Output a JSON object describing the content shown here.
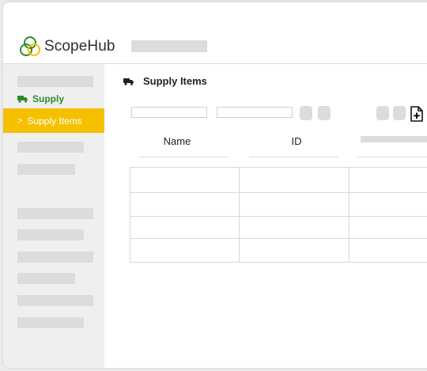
{
  "app": {
    "name": "ScopeHub",
    "brand_green": "#2e8b2e",
    "accent_yellow": "#f5c000"
  },
  "sidebar": {
    "section_label": "Supply",
    "section_icon": "truck-icon",
    "active_item": {
      "label": "Supply Items",
      "chevron": ">"
    }
  },
  "main": {
    "title": "Supply Items",
    "title_icon": "truck-icon",
    "add_icon": "add-document-icon",
    "columns": [
      "Name",
      "ID"
    ]
  }
}
